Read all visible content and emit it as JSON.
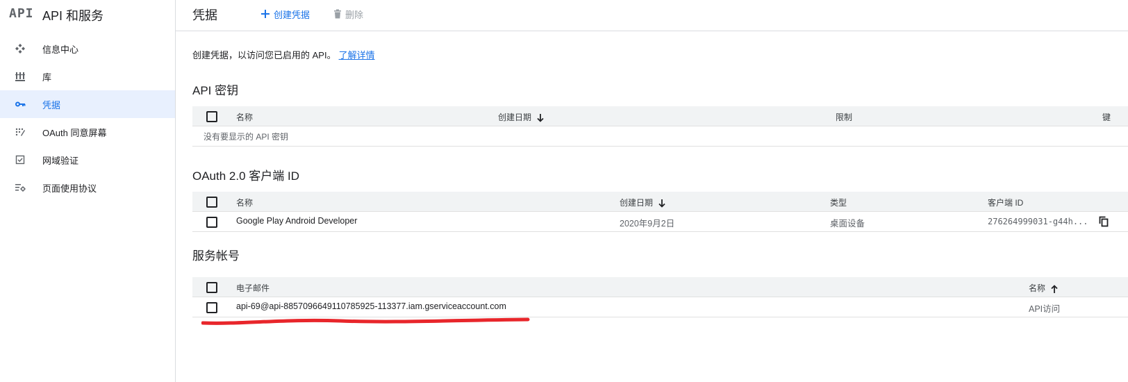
{
  "brand": {
    "logo": "API",
    "title": "API 和服务"
  },
  "sidebar": {
    "items": [
      {
        "label": "信息中心",
        "icon": "dashboard-icon"
      },
      {
        "label": "库",
        "icon": "library-icon"
      },
      {
        "label": "凭据",
        "icon": "key-icon",
        "active": true
      },
      {
        "label": "OAuth 同意屏幕",
        "icon": "consent-icon"
      },
      {
        "label": "网域验证",
        "icon": "domain-verify-icon"
      },
      {
        "label": "页面使用协议",
        "icon": "settings-list-icon"
      }
    ]
  },
  "header": {
    "title": "凭据",
    "create_label": "创建凭据",
    "delete_label": "删除"
  },
  "intro": {
    "text": "创建凭据，以访问您已启用的 API。",
    "link": "了解详情"
  },
  "api_keys": {
    "title": "API 密钥",
    "columns": {
      "name": "名称",
      "date": "创建日期",
      "limit": "限制",
      "key": "键"
    },
    "empty": "没有要显示的 API 密钥"
  },
  "oauth": {
    "title": "OAuth 2.0 客户端 ID",
    "columns": {
      "name": "名称",
      "date": "创建日期",
      "type": "类型",
      "client_id": "客户端 ID"
    },
    "rows": [
      {
        "name": "Google Play Android Developer",
        "date": "2020年9月2日",
        "type": "桌面设备",
        "client_id": "276264999031-g44h..."
      }
    ]
  },
  "service_accounts": {
    "title": "服务帐号",
    "columns": {
      "email": "电子邮件",
      "name": "名称"
    },
    "rows": [
      {
        "email": "api-69@api-8857096649110785925-113377.iam.gserviceaccount.com",
        "name": "API访问"
      }
    ]
  },
  "colors": {
    "accent": "#1a73e8",
    "active_bg": "#e8f0fe",
    "annotation": "#e8262b"
  }
}
